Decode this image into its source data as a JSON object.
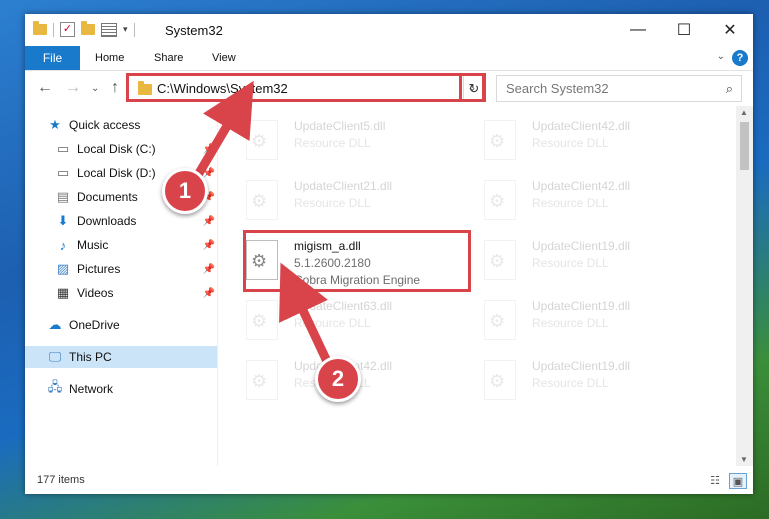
{
  "window": {
    "title": "System32"
  },
  "ribbon": {
    "tabs": [
      "File",
      "Home",
      "Share",
      "View"
    ]
  },
  "address": {
    "path": "C:\\Windows\\System32"
  },
  "search": {
    "placeholder": "Search System32"
  },
  "sidebar": {
    "items": [
      {
        "label": "Quick access",
        "icon": "star-icon",
        "pinned": false
      },
      {
        "label": "Local Disk (C:)",
        "icon": "drive-icon",
        "pinned": true
      },
      {
        "label": "Local Disk (D:)",
        "icon": "drive-icon",
        "pinned": true
      },
      {
        "label": "Documents",
        "icon": "documents-icon",
        "pinned": true
      },
      {
        "label": "Downloads",
        "icon": "downloads-icon",
        "pinned": true
      },
      {
        "label": "Music",
        "icon": "music-icon",
        "pinned": true
      },
      {
        "label": "Pictures",
        "icon": "pictures-icon",
        "pinned": true
      },
      {
        "label": "Videos",
        "icon": "videos-icon",
        "pinned": true
      },
      {
        "label": "OneDrive",
        "icon": "cloud-icon",
        "pinned": false
      },
      {
        "label": "This PC",
        "icon": "computer-icon",
        "pinned": false,
        "selected": true
      },
      {
        "label": "Network",
        "icon": "network-icon",
        "pinned": false
      }
    ]
  },
  "files": {
    "left": [
      {
        "name": "UpdateClient5.dll",
        "type": "Resource DLL"
      },
      {
        "name": "UpdateClient21.dll",
        "type": "Resource DLL"
      },
      {
        "name": "migism_a.dll",
        "version": "5.1.2600.2180",
        "description": "Cobra Migration Engine"
      },
      {
        "name": "UpdateClient63.dll",
        "type": "Resource DLL"
      },
      {
        "name": "UpdateClient42.dll",
        "type": "Resource DLL"
      }
    ],
    "right": [
      {
        "name": "UpdateClient42.dll",
        "type": "Resource DLL"
      },
      {
        "name": "UpdateClient42.dll",
        "type": "Resource DLL"
      },
      {
        "name": "UpdateClient19.dll",
        "type": "Resource DLL"
      },
      {
        "name": "UpdateClient19.dll",
        "type": "Resource DLL"
      },
      {
        "name": "UpdateClient19.dll",
        "type": "Resource DLL"
      }
    ]
  },
  "status": {
    "count": "177 items"
  },
  "callouts": [
    "1",
    "2"
  ],
  "colors": {
    "accent": "#1979ca",
    "highlight": "#d9444b",
    "selected": "#cce4f7"
  }
}
